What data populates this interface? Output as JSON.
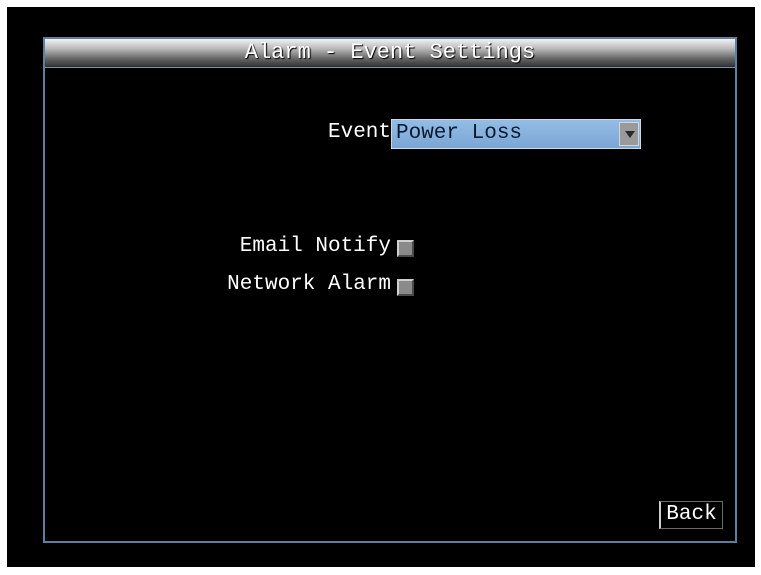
{
  "window": {
    "title": "Alarm - Event Settings"
  },
  "event": {
    "label": "Event",
    "selected": "Power Loss",
    "dropdown_icon": "chevron-down-icon"
  },
  "email_notify": {
    "label": "Email Notify",
    "checked": false
  },
  "network_alarm": {
    "label": "Network Alarm",
    "checked": false
  },
  "footer": {
    "back_label": "Back"
  },
  "colors": {
    "background": "#000000",
    "dialog_border": "#5f7f9f",
    "dropdown_fill": "#86b2dc",
    "text": "#ffffff"
  }
}
